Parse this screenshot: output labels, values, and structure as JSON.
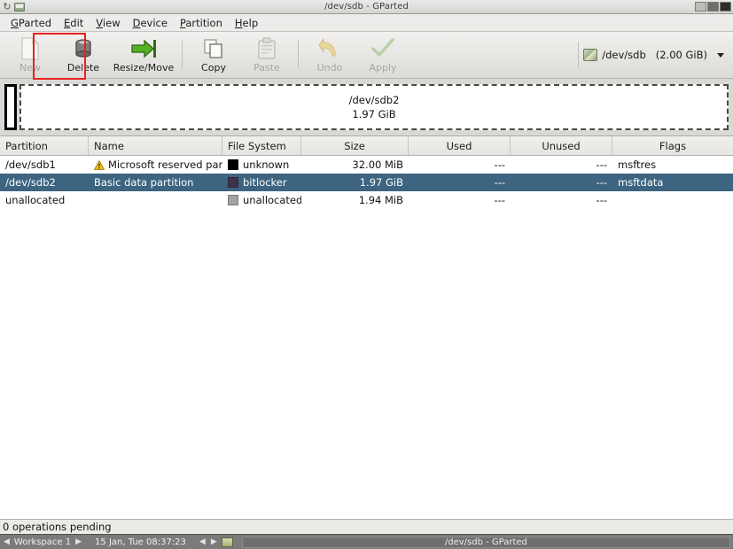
{
  "titlebar": {
    "title": "/dev/sdb - GParted",
    "refresh_icon": "refresh-icon",
    "app_icon": "gparted-app-icon",
    "buttons": [
      "minimize",
      "maximize",
      "close"
    ]
  },
  "menubar": {
    "items": [
      {
        "label": "GParted",
        "mnemonic": "G"
      },
      {
        "label": "Edit",
        "mnemonic": "E"
      },
      {
        "label": "View",
        "mnemonic": "V"
      },
      {
        "label": "Device",
        "mnemonic": "D"
      },
      {
        "label": "Partition",
        "mnemonic": "P"
      },
      {
        "label": "Help",
        "mnemonic": "H"
      }
    ]
  },
  "toolbar": {
    "new_label": "New",
    "delete_label": "Delete",
    "resize_move_label": "Resize/Move",
    "copy_label": "Copy",
    "paste_label": "Paste",
    "undo_label": "Undo",
    "apply_label": "Apply",
    "highlight_color": "#e8221f",
    "highlighted_button": "Delete",
    "device": {
      "icon": "hard-disk-icon",
      "name": "/dev/sdb",
      "size": "(2.00 GiB)",
      "dropdown_icon": "chevron-down-icon"
    }
  },
  "graphic": {
    "small_partition_label": "",
    "selected_partition": {
      "name": "/dev/sdb2",
      "size": "1.97 GiB"
    }
  },
  "table": {
    "columns": [
      {
        "key": "partition",
        "label": "Partition"
      },
      {
        "key": "name",
        "label": "Name"
      },
      {
        "key": "filesystem",
        "label": "File System"
      },
      {
        "key": "size",
        "label": "Size"
      },
      {
        "key": "used",
        "label": "Used"
      },
      {
        "key": "unused",
        "label": "Unused"
      },
      {
        "key": "flags",
        "label": "Flags"
      }
    ],
    "rows": [
      {
        "partition": "/dev/sdb1",
        "name": "Microsoft reserved partition",
        "filesystem": "unknown",
        "fs_color": "#000000",
        "size": "32.00 MiB",
        "used": "---",
        "unused": "---",
        "flags": "msftres",
        "warning": true,
        "selected": false
      },
      {
        "partition": "/dev/sdb2",
        "name": "Basic data partition",
        "filesystem": "bitlocker",
        "fs_color": "#40324b",
        "size": "1.97 GiB",
        "used": "---",
        "unused": "---",
        "flags": "msftdata",
        "warning": false,
        "selected": true
      },
      {
        "partition": "unallocated",
        "name": "",
        "filesystem": "unallocated",
        "fs_color": "#a3a3a3",
        "size": "1.94 MiB",
        "used": "---",
        "unused": "---",
        "flags": "",
        "warning": false,
        "selected": false
      }
    ],
    "selection_color": "#3d6480"
  },
  "statusbar": {
    "text": "0 operations pending"
  },
  "taskbar": {
    "prev_workspace_icon": "left-arrow-icon",
    "workspace_label": "Workspace 1",
    "next_workspace_icon": "right-arrow-icon",
    "clock": "15 Jan, Tue 08:37:23",
    "prev_icon": "left-arrow-icon",
    "next_icon": "right-arrow-icon",
    "window_icon": "window-icon",
    "task_label": "/dev/sdb - GParted"
  }
}
